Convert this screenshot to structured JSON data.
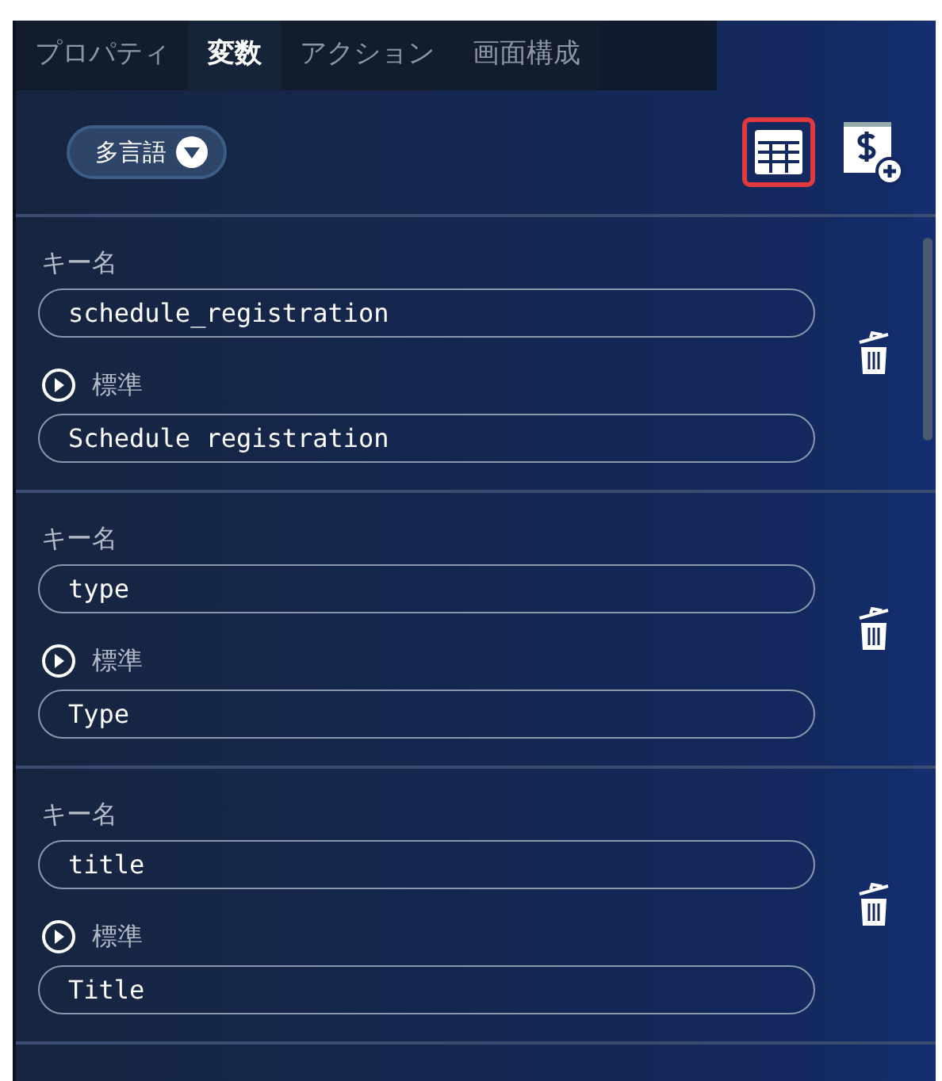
{
  "tabs": [
    {
      "label": "プロパティ",
      "selected": false
    },
    {
      "label": "変数",
      "selected": true
    },
    {
      "label": "アクション",
      "selected": false
    },
    {
      "label": "画面構成",
      "selected": false
    }
  ],
  "language_dropdown": {
    "label": "多言語"
  },
  "toolbar": {
    "table_view_selected": true
  },
  "variables": [
    {
      "key_label": "キー名",
      "key": "schedule_registration",
      "value_label": "標準",
      "value": "Schedule registration"
    },
    {
      "key_label": "キー名",
      "key": "type",
      "value_label": "標準",
      "value": "Type"
    },
    {
      "key_label": "キー名",
      "key": "title",
      "value_label": "標準",
      "value": "Title"
    }
  ]
}
